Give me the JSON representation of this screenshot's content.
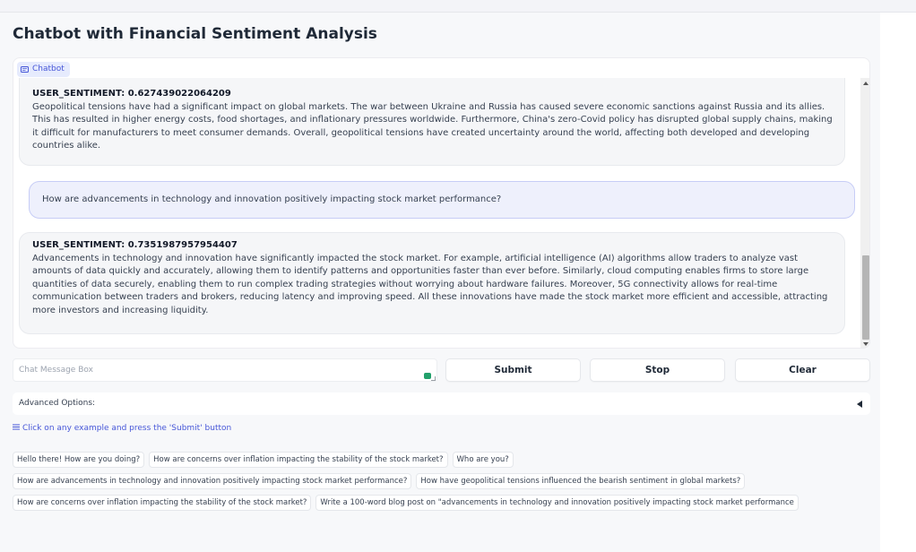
{
  "page": {
    "title": "Chatbot with Financial Sentiment Analysis"
  },
  "chatbot": {
    "label": "Chatbot",
    "messages": [
      {
        "role": "bot",
        "sentiment": "USER_SENTIMENT: 0.627439022064209",
        "text": "Geopolitical tensions have had a significant impact on global markets. The war between Ukraine and Russia has caused severe economic sanctions against Russia and its allies. This has resulted in higher energy costs, food shortages, and inflationary pressures worldwide. Furthermore, China's zero-Covid policy has disrupted global supply chains, making it difficult for manufacturers to meet consumer demands. Overall, geopolitical tensions have created uncertainty around the world, affecting both developed and developing countries alike."
      },
      {
        "role": "user",
        "text": "How are advancements in technology and innovation positively impacting stock market performance?"
      },
      {
        "role": "bot",
        "sentiment": "USER_SENTIMENT: 0.7351987957954407",
        "text": "Advancements in technology and innovation have significantly impacted the stock market. For example, artificial intelligence (AI) algorithms allow traders to analyze vast amounts of data quickly and accurately, allowing them to identify patterns and opportunities faster than ever before. Similarly, cloud computing enables firms to store large quantities of data securely, enabling them to run complex trading strategies without worrying about hardware failures. Moreover, 5G connectivity allows for real-time communication between traders and brokers, reducing latency and improving speed. All these innovations have made the stock market more efficient and accessible, attracting more investors and increasing liquidity."
      }
    ]
  },
  "input": {
    "placeholder": "Chat Message Box",
    "value": ""
  },
  "buttons": {
    "submit": "Submit",
    "stop": "Stop",
    "clear": "Clear"
  },
  "advanced": {
    "label": "Advanced Options:"
  },
  "examples": {
    "header": "Click on any example and press the 'Submit' button",
    "rows": [
      [
        "Hello there! How are you doing?",
        "How are concerns over inflation impacting the stability of the stock market?",
        "Who are you?"
      ],
      [
        "How are advancements in technology and innovation positively impacting stock market performance?",
        "How have geopolitical tensions influenced the bearish sentiment in global markets?"
      ],
      [
        "How are concerns over inflation impacting the stability of the stock market?",
        "Write a 100-word blog post on \"advancements in technology and innovation positively impacting stock market performance"
      ]
    ]
  },
  "colors": {
    "accent": "#4757d8",
    "user_bubble": "#eef0fc",
    "bot_bubble": "#f5f6f8"
  }
}
